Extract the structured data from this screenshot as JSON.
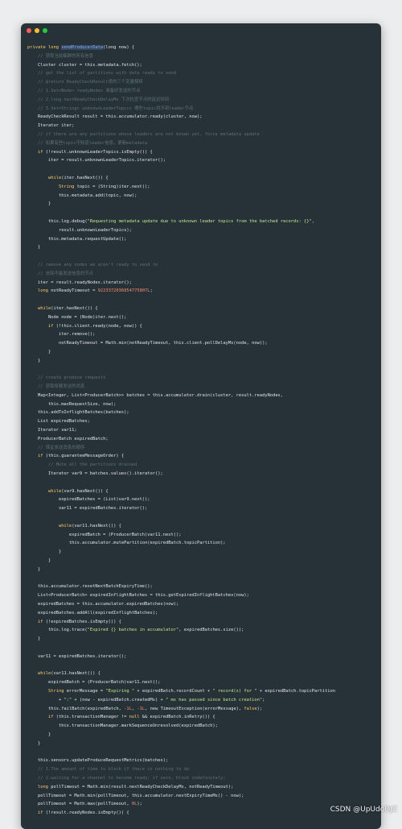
{
  "colors": {
    "window_bg": "#263238",
    "plain": "#dfe3e6",
    "keyword": "#ffcb6b",
    "method": "#82aaff",
    "comment": "#5d7077",
    "string": "#c3e88d",
    "number": "#f78c6c",
    "type": "#ffcb6b",
    "dot_red": "#ff5f57",
    "dot_yellow": "#febc2e",
    "dot_green": "#28c840"
  },
  "window": {
    "controls": [
      "close-dot",
      "minimize-dot",
      "zoom-dot"
    ]
  },
  "code_lines": [
    [
      [
        "k",
        "private long "
      ],
      [
        "m",
        "sendProducerData"
      ],
      [
        "p",
        "(long now) {"
      ]
    ],
    [
      [
        "c",
        "    // 获取当前集群的所有信息"
      ]
    ],
    [
      [
        "p",
        "    Cluster cluster = this.metadata.fetch();"
      ]
    ],
    [
      [
        "c",
        "    // get the list of partitions with data ready to send"
      ]
    ],
    [
      [
        "c",
        "    // @return ReadyCheckResult类的三个变量解释"
      ]
    ],
    [
      [
        "c",
        "    // 1.Set<Node> readyNodes 准备好发送的节点"
      ]
    ],
    [
      [
        "c",
        "    // 2.long nextReadyCheckDelayMs 下次检查节点的延迟时间"
      ]
    ],
    [
      [
        "c",
        "    // 3.Set<String> unknownLeaderTopics 哪些topic找不到leader节点"
      ]
    ],
    [
      [
        "p",
        "    ReadyCheckResult result = this.accumulator.ready(cluster, now);"
      ]
    ],
    [
      [
        "p",
        "    Iterator iter;"
      ]
    ],
    [
      [
        "c",
        "    // if there are any partitions whose leaders are not known yet, force metadata update"
      ]
    ],
    [
      [
        "c",
        "    // 如果有些topic不知道leader信息，更新metadata"
      ]
    ],
    [
      [
        "k",
        "    if "
      ],
      [
        "p",
        "(!result.unknownLeaderTopics.isEmpty()) {"
      ]
    ],
    [
      [
        "p",
        "        iter = result.unknownLeaderTopics.iterator();"
      ]
    ],
    [
      [
        "p",
        ""
      ]
    ],
    [
      [
        "k",
        "        while"
      ],
      [
        "p",
        "(iter.hasNext()) {"
      ]
    ],
    [
      [
        "t",
        "            String "
      ],
      [
        "p",
        "topic = (String)iter.next();"
      ]
    ],
    [
      [
        "p",
        "            this.metadata.add(topic, now);"
      ]
    ],
    [
      [
        "p",
        "        }"
      ]
    ],
    [
      [
        "p",
        ""
      ]
    ],
    [
      [
        "p",
        "        this.log.debug("
      ],
      [
        "s",
        "\"Requesting metadata update due to unknown leader topics from the batched records: {}\""
      ],
      [
        "p",
        ","
      ]
    ],
    [
      [
        "p",
        "            result.unknownLeaderTopics);"
      ]
    ],
    [
      [
        "p",
        "        this.metadata.requestUpdate();"
      ]
    ],
    [
      [
        "p",
        "    }"
      ]
    ],
    [
      [
        "p",
        ""
      ]
    ],
    [
      [
        "c",
        "    // remove any nodes we aren't ready to send to"
      ]
    ],
    [
      [
        "c",
        "    // 去除不能发送信息的节点"
      ]
    ],
    [
      [
        "p",
        "    iter = result.readyNodes.iterator();"
      ]
    ],
    [
      [
        "k",
        "    long "
      ],
      [
        "p",
        "notReadyTimeout = "
      ],
      [
        "n",
        "9223372036854775807L"
      ],
      [
        "p",
        ";"
      ]
    ],
    [
      [
        "p",
        ""
      ]
    ],
    [
      [
        "k",
        "    while"
      ],
      [
        "p",
        "(iter.hasNext()) {"
      ]
    ],
    [
      [
        "p",
        "        Node node = (Node)iter.next();"
      ]
    ],
    [
      [
        "k",
        "        if "
      ],
      [
        "p",
        "(!this.client.ready(node, now)) {"
      ]
    ],
    [
      [
        "p",
        "            iter.remove();"
      ]
    ],
    [
      [
        "p",
        "            notReadyTimeout = Math.min(notReadyTimeout, this.client.pollDelayMs(node, now));"
      ]
    ],
    [
      [
        "p",
        "        }"
      ]
    ],
    [
      [
        "p",
        "    }"
      ]
    ],
    [
      [
        "p",
        ""
      ]
    ],
    [
      [
        "c",
        "    // create produce requests"
      ]
    ],
    [
      [
        "c",
        "    // 获取将要发送的消息"
      ]
    ],
    [
      [
        "p",
        "    Map<Integer, List<ProducerBatch>> batches = this.accumulator.drain(cluster, result.readyNodes,"
      ]
    ],
    [
      [
        "p",
        "        this.maxRequestSize, now);"
      ]
    ],
    [
      [
        "p",
        "    this.addToInflightBatches(batches);"
      ]
    ],
    [
      [
        "p",
        "    List expiredBatches;"
      ]
    ],
    [
      [
        "p",
        "    Iterator var11;"
      ]
    ],
    [
      [
        "p",
        "    ProducerBatch expiredBatch;"
      ]
    ],
    [
      [
        "c",
        "    // 保证发送消息的顺序"
      ]
    ],
    [
      [
        "k",
        "    if "
      ],
      [
        "p",
        "(this.guaranteeMessageOrder) {"
      ]
    ],
    [
      [
        "c",
        "        // Mute all the partitions drained"
      ]
    ],
    [
      [
        "p",
        "        Iterator var9 = batches.values().iterator();"
      ]
    ],
    [
      [
        "p",
        ""
      ]
    ],
    [
      [
        "k",
        "        while"
      ],
      [
        "p",
        "(var9.hasNext()) {"
      ]
    ],
    [
      [
        "p",
        "            expiredBatches = (List)var9.next();"
      ]
    ],
    [
      [
        "p",
        "            var11 = expiredBatches.iterator();"
      ]
    ],
    [
      [
        "p",
        ""
      ]
    ],
    [
      [
        "k",
        "            while"
      ],
      [
        "p",
        "(var11.hasNext()) {"
      ]
    ],
    [
      [
        "p",
        "                expiredBatch = (ProducerBatch)var11.next();"
      ]
    ],
    [
      [
        "p",
        "                this.accumulator.mutePartition(expiredBatch.topicPartition);"
      ]
    ],
    [
      [
        "p",
        "            }"
      ]
    ],
    [
      [
        "p",
        "        }"
      ]
    ],
    [
      [
        "p",
        "    }"
      ]
    ],
    [
      [
        "p",
        ""
      ]
    ],
    [
      [
        "p",
        "    this.accumulator.resetNextBatchExpiryTime();"
      ]
    ],
    [
      [
        "p",
        "    List<ProducerBatch> expiredInflightBatches = this.getExpiredInflightBatches(now);"
      ]
    ],
    [
      [
        "p",
        "    expiredBatches = this.accumulator.expiredBatches(now);"
      ]
    ],
    [
      [
        "p",
        "    expiredBatches.addAll(expiredInflightBatches);"
      ]
    ],
    [
      [
        "k",
        "    if "
      ],
      [
        "p",
        "(!expiredBatches.isEmpty()) {"
      ]
    ],
    [
      [
        "p",
        "        this.log.trace("
      ],
      [
        "s",
        "\"Expired {} batches in accumulator\""
      ],
      [
        "p",
        ", expiredBatches.size());"
      ]
    ],
    [
      [
        "p",
        "    }"
      ]
    ],
    [
      [
        "p",
        ""
      ]
    ],
    [
      [
        "p",
        "    var11 = expiredBatches.iterator();"
      ]
    ],
    [
      [
        "p",
        ""
      ]
    ],
    [
      [
        "k",
        "    while"
      ],
      [
        "p",
        "(var11.hasNext()) {"
      ]
    ],
    [
      [
        "p",
        "        expiredBatch = (ProducerBatch)var11.next();"
      ]
    ],
    [
      [
        "t",
        "        String "
      ],
      [
        "p",
        "errorMessage = "
      ],
      [
        "s",
        "\"Expiring \""
      ],
      [
        "p",
        " + expiredBatch.recordCount + "
      ],
      [
        "s",
        "\" record(s) for \""
      ],
      [
        "p",
        " + expiredBatch.topicPartition"
      ]
    ],
    [
      [
        "p",
        "            + "
      ],
      [
        "s",
        "\":\""
      ],
      [
        "p",
        " + (now - expiredBatch.createdMs) + "
      ],
      [
        "s",
        "\" ms has passed since batch creation\""
      ],
      [
        "p",
        ";"
      ]
    ],
    [
      [
        "p",
        "        this.failBatch(expiredBatch, "
      ],
      [
        "n",
        "-1L"
      ],
      [
        "p",
        ", "
      ],
      [
        "n",
        "-1L"
      ],
      [
        "p",
        ", new TimeoutException(errorMessage), "
      ],
      [
        "k",
        "false"
      ],
      [
        "p",
        ");"
      ]
    ],
    [
      [
        "k",
        "        if "
      ],
      [
        "p",
        "(this.transactionManager != "
      ],
      [
        "k",
        "null"
      ],
      [
        "p",
        " && expiredBatch.inRetry()) {"
      ]
    ],
    [
      [
        "p",
        "            this.transactionManager.markSequenceUnresolved(expiredBatch);"
      ]
    ],
    [
      [
        "p",
        "        }"
      ]
    ],
    [
      [
        "p",
        "    }"
      ]
    ],
    [
      [
        "p",
        ""
      ]
    ],
    [
      [
        "p",
        "    this.sensors.updateProduceRequestMetrics(batches);"
      ]
    ],
    [
      [
        "c",
        "    // 1.The amount of time to block if there is nothing to do"
      ]
    ],
    [
      [
        "c",
        "    // 2.waiting for a channel to become ready; if zero, block indefinitely;"
      ]
    ],
    [
      [
        "k",
        "    long "
      ],
      [
        "p",
        "pollTimeout = Math.min(result.nextReadyCheckDelayMs, notReadyTimeout);"
      ]
    ],
    [
      [
        "p",
        "    pollTimeout = Math.min(pollTimeout, this.accumulator.nextExpiryTimeMs() - now);"
      ]
    ],
    [
      [
        "p",
        "    pollTimeout = Math.max(pollTimeout, "
      ],
      [
        "n",
        "0L"
      ],
      [
        "p",
        ");"
      ]
    ],
    [
      [
        "k",
        "    if "
      ],
      [
        "p",
        "(!result.readyNodes.isEmpty()) {"
      ]
    ]
  ],
  "watermark": "CSDN @UpUdoDJZ"
}
